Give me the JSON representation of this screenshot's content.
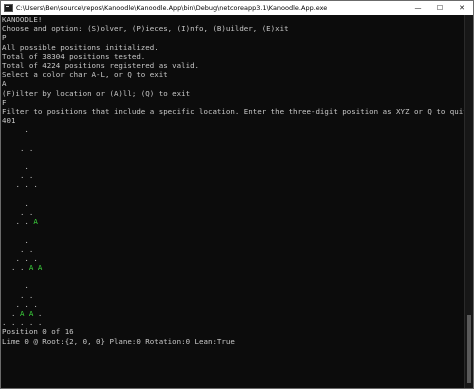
{
  "window": {
    "title": "C:\\Users\\Ben\\source\\repos\\Kanoodle\\Kanoodle.App\\bin\\Debug\\netcoreapp3.1\\Kanoodle.App.exe",
    "buttons": {
      "minimize": "—",
      "maximize": "☐",
      "close": "✕"
    }
  },
  "console": {
    "lines": [
      "KANOODLE!",
      "Choose and option: (S)olver, (P)ieces, (I)nfo, (B)uilder, (E)xit",
      "P",
      "All possible positions initialized.",
      "Total of 38304 positions tested.",
      "Total of 4224 positions registered as valid.",
      "Select a color char A-L, or Q to exit",
      "A",
      "(F)ilter by location or (A)ll; (Q) to exit",
      "F",
      "Filter to positions that include a specific location. Enter the three-digit position as XYZ or Q to quit",
      "401"
    ],
    "grid_lines": [
      "     .",
      "",
      "    . .",
      "",
      "     .",
      "    . .",
      "   . . .",
      "",
      "     .",
      "    . .",
      "   . . A",
      "",
      "     .",
      "    . .",
      "   . . .",
      "  . . A A",
      "",
      "     .",
      "    . .",
      "   . . .",
      "  . A A .",
      ". . . . ."
    ],
    "footer": [
      "Position 0 of 16",
      "Lime 0 @ Root:{2, 0, 0} Plane:0 Rotation:0 Lean:True"
    ]
  }
}
